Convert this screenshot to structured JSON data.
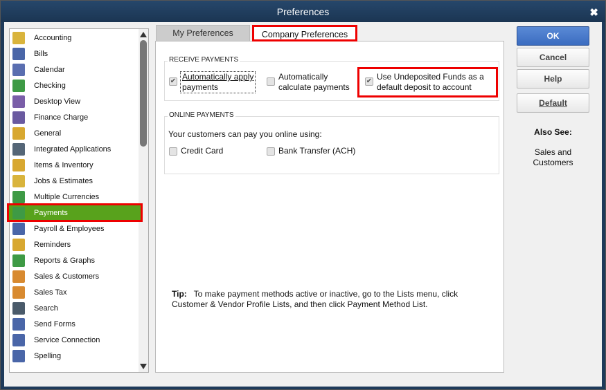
{
  "window": {
    "title": "Preferences",
    "close": "✖"
  },
  "sidebar": {
    "items": [
      {
        "label": "Accounting",
        "icon": "accounting-icon",
        "color": "#d9b43c"
      },
      {
        "label": "Bills",
        "icon": "bills-icon",
        "color": "#4a66a8"
      },
      {
        "label": "Calendar",
        "icon": "calendar-icon",
        "color": "#5a6eb0"
      },
      {
        "label": "Checking",
        "icon": "checking-icon",
        "color": "#3e9a45"
      },
      {
        "label": "Desktop View",
        "icon": "desktop-view-icon",
        "color": "#7a5ea8"
      },
      {
        "label": "Finance Charge",
        "icon": "finance-charge-icon",
        "color": "#6a5aa0"
      },
      {
        "label": "General",
        "icon": "general-icon",
        "color": "#d8a830"
      },
      {
        "label": "Integrated Applications",
        "icon": "integrated-applications-icon",
        "color": "#556677"
      },
      {
        "label": "Items & Inventory",
        "icon": "items-inventory-icon",
        "color": "#d8a830"
      },
      {
        "label": "Jobs & Estimates",
        "icon": "jobs-estimates-icon",
        "color": "#d9b43c"
      },
      {
        "label": "Multiple Currencies",
        "icon": "multiple-currencies-icon",
        "color": "#3e9a45"
      },
      {
        "label": "Payments",
        "icon": "payments-icon",
        "color": "#3e9a45",
        "selected": true
      },
      {
        "label": "Payroll & Employees",
        "icon": "payroll-employees-icon",
        "color": "#4a66a8"
      },
      {
        "label": "Reminders",
        "icon": "reminders-icon",
        "color": "#d8a830"
      },
      {
        "label": "Reports & Graphs",
        "icon": "reports-graphs-icon",
        "color": "#3e9a45"
      },
      {
        "label": "Sales & Customers",
        "icon": "sales-customers-icon",
        "color": "#d88a30"
      },
      {
        "label": "Sales Tax",
        "icon": "sales-tax-icon",
        "color": "#d88a30"
      },
      {
        "label": "Search",
        "icon": "search-icon",
        "color": "#4a5a6a"
      },
      {
        "label": "Send Forms",
        "icon": "send-forms-icon",
        "color": "#4a66a8"
      },
      {
        "label": "Service Connection",
        "icon": "service-connection-icon",
        "color": "#4a66a8"
      },
      {
        "label": "Spelling",
        "icon": "spelling-icon",
        "color": "#4a66a8"
      }
    ]
  },
  "tabs": {
    "my": "My Preferences",
    "company": "Company Preferences"
  },
  "receive": {
    "title": "RECEIVE PAYMENTS",
    "auto_apply": {
      "label1": "Automatically apply",
      "label2": "payments",
      "checked": true
    },
    "auto_calc": {
      "label1": "Automatically",
      "label2": "calculate payments",
      "checked": false
    },
    "undeposited": {
      "label1": "Use Undeposited Funds as a",
      "label2": "default deposit to account",
      "checked": true
    }
  },
  "online": {
    "title": "ONLINE PAYMENTS",
    "intro": "Your customers can pay you online using:",
    "credit_card": {
      "label": "Credit Card",
      "checked": false
    },
    "ach": {
      "label": "Bank Transfer (ACH)",
      "checked": false
    }
  },
  "tip": {
    "label": "Tip:",
    "line1": "To make payment methods active or inactive, go to the Lists menu, click",
    "line2": "Customer & Vendor Profile Lists, and then click Payment Method List."
  },
  "buttons": {
    "ok": "OK",
    "cancel": "Cancel",
    "help": "Help",
    "default": "Default"
  },
  "also_see": {
    "title": "Also See:",
    "link1": "Sales and",
    "link2": "Customers"
  },
  "colors": {
    "selected": "#58a21c",
    "highlight": "#e00000",
    "title_bar": "#1e3a5a"
  }
}
